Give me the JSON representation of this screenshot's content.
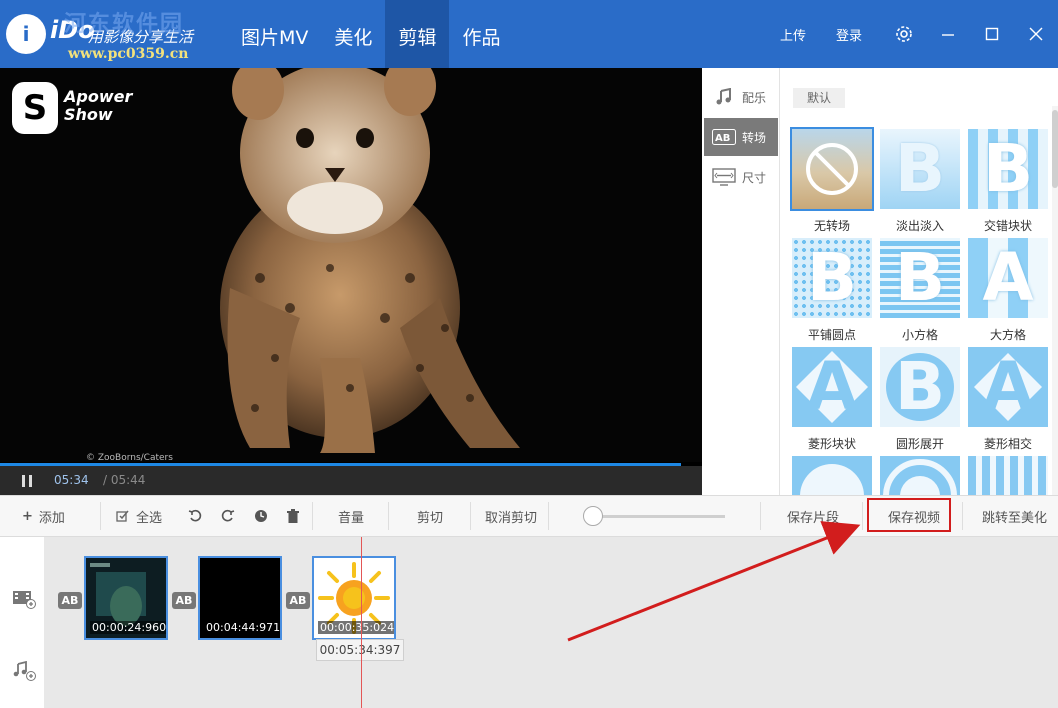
{
  "app": {
    "logo_mark": "iDo",
    "slogan": "用影像分享生活",
    "watermark_cn": "河东软件园",
    "watermark_url": "www.pc0359.cn"
  },
  "nav": {
    "items": [
      "图片MV",
      "美化",
      "剪辑",
      "作品"
    ],
    "active": "剪辑"
  },
  "top_actions": {
    "upload": "上传",
    "login": "登录"
  },
  "player": {
    "logo_text_line1": "Apower",
    "logo_text_line2": "Show",
    "credit": "© ZooBorns/Caters",
    "current_time": "05:34",
    "total_time": "/ 05:44",
    "progress_fraction": 0.97
  },
  "side_tabs": [
    {
      "label": "配乐",
      "icon": "music-note-icon"
    },
    {
      "label": "转场",
      "icon": "ab-transition-icon",
      "active": true
    },
    {
      "label": "尺寸",
      "icon": "resize-icon"
    }
  ],
  "transitions": {
    "category": "默认",
    "items": [
      "无转场",
      "淡出淡入",
      "交错块状",
      "平铺圆点",
      "小方格",
      "大方格",
      "菱形块状",
      "圆形展开",
      "菱形相交"
    ],
    "selected": "无转场"
  },
  "toolbar": {
    "add": "添加",
    "select_all": "全选",
    "volume": "音量",
    "cut": "剪切",
    "uncut": "取消剪切",
    "save_segment": "保存片段",
    "save_video": "保存视频",
    "goto_beautify": "跳转至美化"
  },
  "timeline": {
    "ab_label": "AB",
    "clips": [
      {
        "time": "00:00:24:960"
      },
      {
        "time": "00:04:44:971"
      },
      {
        "time": "00:00:35:024"
      }
    ],
    "tooltip": "00:05:34:397"
  },
  "colors": {
    "brand_blue": "#2a6cc8",
    "highlight_red": "#d21d1d",
    "accent_blue": "#3b8de0"
  }
}
